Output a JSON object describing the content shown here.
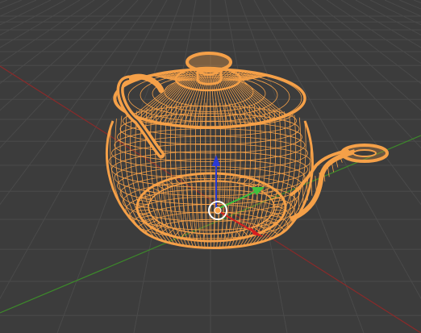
{
  "viewport": {
    "mode": "wireframe",
    "selected_object": "teapot",
    "colors": {
      "background": "#3c3c3c",
      "grid_line": "#4a4a4a",
      "x_axis": "#8a2a2a",
      "y_axis": "#3c8a2a",
      "selection_wire": "#f5a048",
      "gizmo_x": "#d62020",
      "gizmo_y": "#3ec23e",
      "gizmo_z": "#2a3ad6",
      "origin_ring": "#ffffff"
    }
  },
  "icons": {
    "move_gizmo": "transform-arrows-icon",
    "origin": "object-origin-icon"
  }
}
